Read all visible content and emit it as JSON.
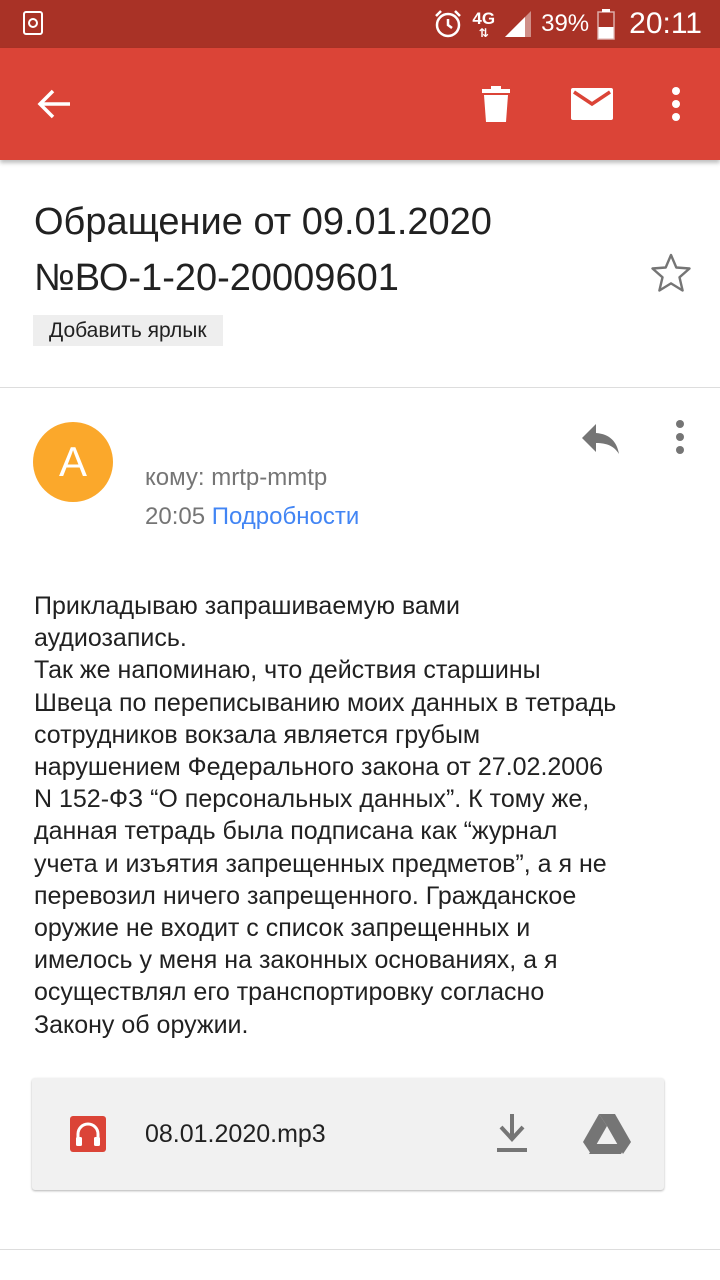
{
  "status_bar": {
    "network": "4G",
    "battery": "39%",
    "time": "20:11",
    "icons": [
      "recycle-icon",
      "alarm-icon",
      "data-arrows-icon",
      "signal-icon",
      "battery-icon"
    ]
  },
  "app_bar": {
    "icons": [
      "back-arrow-icon",
      "trash-icon",
      "mail-icon",
      "more-vert-icon"
    ],
    "color": "#db4437"
  },
  "email": {
    "subject_line1": "Обращение от 09.01.2020",
    "subject_line2": "№ВО-1-20-20009601",
    "add_label": "Добавить ярлык",
    "avatar_letter": "A",
    "avatar_color": "#fba82b",
    "to": "кому: mrtp-mmtp",
    "time": "20:05",
    "details_link": "Подробности",
    "body_lines": [
      "Прикладываю запрашиваемую вами",
      "аудиозапись.",
      "Так же напоминаю, что действия старшины",
      "Швеца по переписыванию моих данных в тетрадь",
      "сотрудников вокзала является грубым",
      "нарушением Федерального закона от 27.02.2006",
      "N 152-ФЗ “О персональных данных”.  К тому же,",
      "данная тетрадь была подписана как “журнал",
      "учета и изъятия запрещенных предметов”, а я не",
      "перевозил ничего запрещенного. Гражданское",
      "оружие не входит с список запрещенных и",
      "имелось у меня на законных основаниях, а я",
      "осуществлял его транспортировку согласно",
      "Закону об оружии."
    ]
  },
  "attachment": {
    "file_name": "08.01.2020.mp3",
    "icons": [
      "headphones-icon",
      "download-icon",
      "drive-icon"
    ]
  }
}
